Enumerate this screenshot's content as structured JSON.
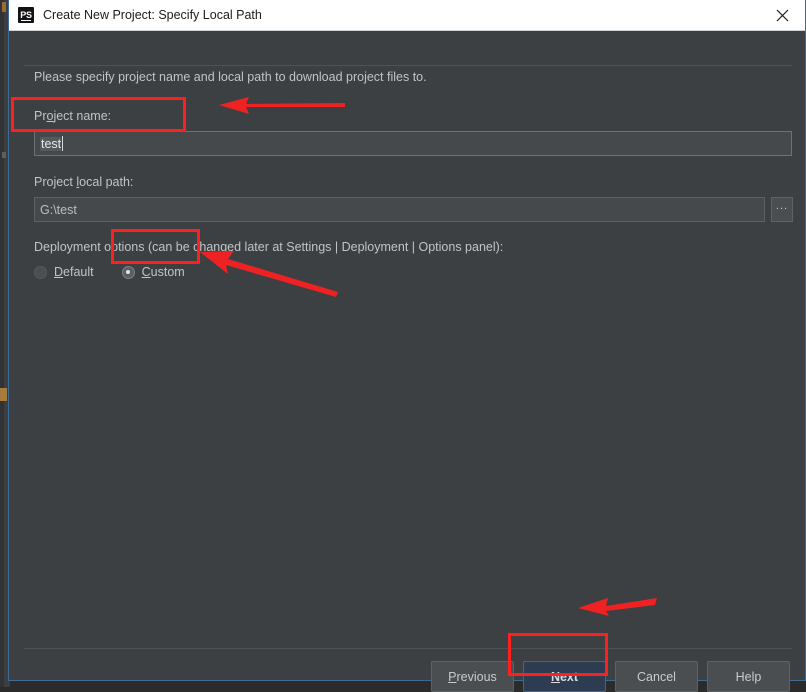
{
  "window": {
    "title": "Create New Project: Specify Local Path",
    "app_icon": "phpstorm-ps-icon",
    "close_icon": "close-x-icon"
  },
  "dialog": {
    "intro_text": "Please specify project name and local path to download project files to.",
    "fields": {
      "project_name": {
        "label_prefix": "Pr",
        "label_mnemonic": "o",
        "label_suffix": "ject name:",
        "label_full": "Project name:",
        "value": "test"
      },
      "project_local_path": {
        "label_prefix": "Project ",
        "label_mnemonic": "l",
        "label_suffix": "ocal path:",
        "label_full": "Project local path:",
        "value": "G:\\test",
        "browse_button_label": "...",
        "browse_icon": "ellipsis-icon"
      }
    },
    "deployment": {
      "group_label": "Deployment options (can be changed later at Settings | Deployment | Options panel):",
      "options": [
        {
          "label_mnemonic": "D",
          "label_suffix": "efault",
          "label_full": "Default",
          "selected": false
        },
        {
          "label_mnemonic": "C",
          "label_suffix": "ustom",
          "label_full": "Custom",
          "selected": true
        }
      ]
    },
    "buttons": [
      {
        "mnemonic": "P",
        "suffix": "revious",
        "full": "Previous",
        "default": false
      },
      {
        "mnemonic": "N",
        "suffix": "ext",
        "full": "Next",
        "default": true
      },
      {
        "mnemonic": "",
        "suffix": "Cancel",
        "full": "Cancel",
        "default": false
      },
      {
        "mnemonic": "",
        "suffix": "Help",
        "full": "Help",
        "default": false
      }
    ]
  },
  "annotations": {
    "highlight_color": "#ff1f1f",
    "arrow_color": "#ee2222",
    "boxes": [
      {
        "target": "project-name-input"
      },
      {
        "target": "custom-radio"
      },
      {
        "target": "next-button"
      }
    ],
    "arrows": [
      {
        "target": "project-name-input",
        "direction": "left"
      },
      {
        "target": "custom-radio",
        "direction": "up-left"
      },
      {
        "target": "next-button",
        "direction": "left"
      }
    ]
  },
  "colors": {
    "dialog_background": "#3c4043",
    "titlebar_background": "#ffffff",
    "text_primary": "#bfc4c8",
    "input_background": "#45494c",
    "default_button_background": "#2e3c52",
    "dialog_border": "#3e6a96"
  }
}
